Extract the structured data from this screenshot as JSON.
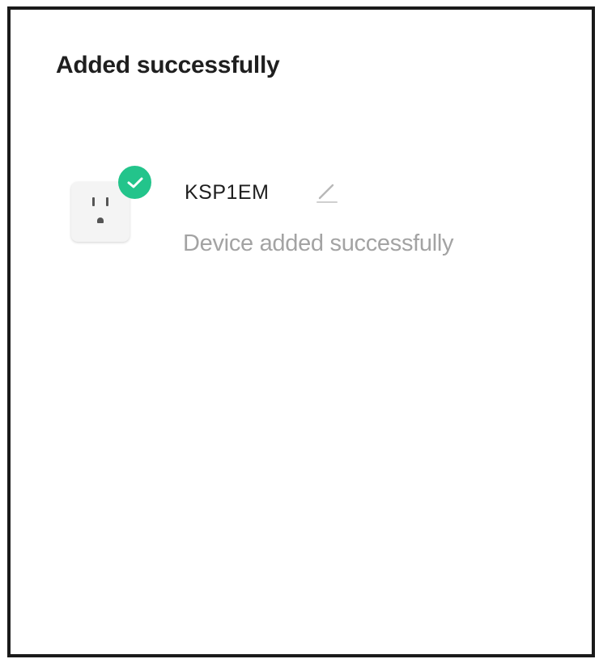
{
  "page": {
    "title": "Added successfully"
  },
  "device": {
    "name": "KSP1EM",
    "status": "Device added successfully",
    "icon": "smart-plug-icon",
    "badge_icon": "check-icon",
    "edit_icon": "edit-pencil-icon"
  },
  "colors": {
    "badge": "#23c48b",
    "title_text": "#1f1f1f",
    "status_text": "#a3a3a3"
  }
}
